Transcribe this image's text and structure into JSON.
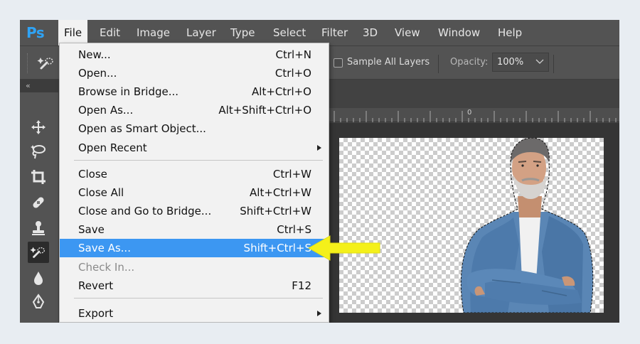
{
  "app": {
    "logo": "Ps",
    "menus": [
      "File",
      "Edit",
      "Image",
      "Layer",
      "Type",
      "Select",
      "Filter",
      "3D",
      "View",
      "Window",
      "Help"
    ],
    "active_menu": "File"
  },
  "options_bar": {
    "tool_icon": "quick-selection-icon",
    "sample_all_layers_label": "Sample All Layers",
    "sample_all_layers_checked": false,
    "opacity_label": "Opacity:",
    "opacity_value": "100%"
  },
  "toolbar": {
    "collapse_glyph": "«",
    "tools": [
      "move-icon",
      "lasso-icon",
      "crop-icon",
      "healing-brush-icon",
      "clone-stamp-icon",
      "quick-selection-icon",
      "blur-drop-icon",
      "pen-icon"
    ],
    "selected_tool": "quick-selection-icon"
  },
  "ruler": {
    "zero_label": "0"
  },
  "file_menu": {
    "group1": [
      {
        "label": "New...",
        "shortcut": "Ctrl+N"
      },
      {
        "label": "Open...",
        "shortcut": "Ctrl+O"
      },
      {
        "label": "Browse in Bridge...",
        "shortcut": "Alt+Ctrl+O"
      },
      {
        "label": "Open As...",
        "shortcut": "Alt+Shift+Ctrl+O"
      },
      {
        "label": "Open as Smart Object...",
        "shortcut": ""
      },
      {
        "label": "Open Recent",
        "shortcut": "",
        "submenu": true
      }
    ],
    "group2": [
      {
        "label": "Close",
        "shortcut": "Ctrl+W"
      },
      {
        "label": "Close All",
        "shortcut": "Alt+Ctrl+W"
      },
      {
        "label": "Close and Go to Bridge...",
        "shortcut": "Shift+Ctrl+W"
      },
      {
        "label": "Save",
        "shortcut": "Ctrl+S"
      },
      {
        "label": "Save As...",
        "shortcut": "Shift+Ctrl+S",
        "highlighted": true
      },
      {
        "label": "Check In...",
        "shortcut": "",
        "disabled": true
      },
      {
        "label": "Revert",
        "shortcut": "F12"
      }
    ],
    "group3": [
      {
        "label": "Export",
        "shortcut": "",
        "submenu": true
      }
    ]
  },
  "colors": {
    "highlight": "#3c97f2",
    "pointer_arrow": "#f4f01a",
    "ps_logo": "#2fa3f5"
  }
}
